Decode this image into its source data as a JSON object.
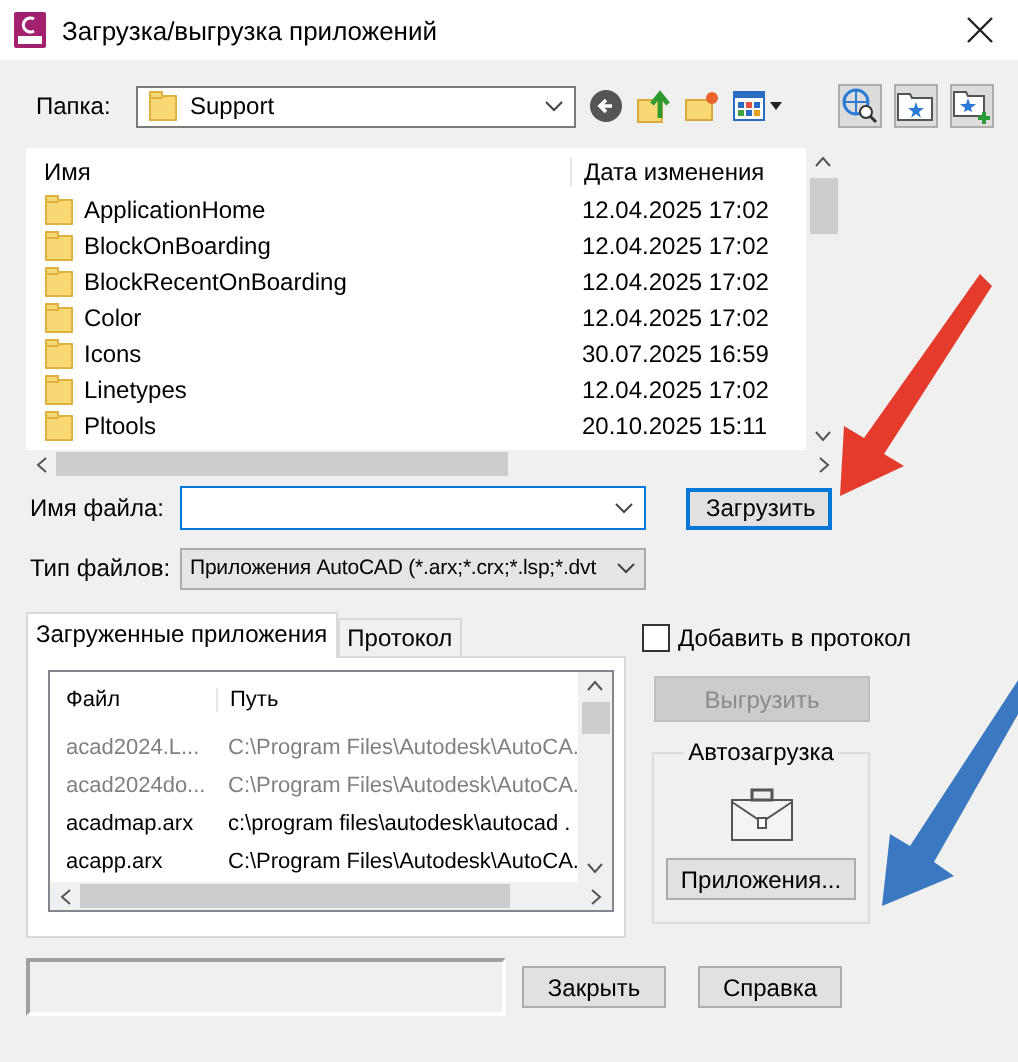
{
  "window": {
    "title": "Загрузка/выгрузка приложений"
  },
  "folder": {
    "label": "Папка:",
    "value": "Support"
  },
  "file_list": {
    "columns": [
      "Имя",
      "Дата изменения"
    ],
    "rows": [
      {
        "name": "ApplicationHome",
        "date": "12.04.2025 17:02"
      },
      {
        "name": "BlockOnBoarding",
        "date": "12.04.2025 17:02"
      },
      {
        "name": "BlockRecentOnBoarding",
        "date": "12.04.2025 17:02"
      },
      {
        "name": "Color",
        "date": "12.04.2025 17:02"
      },
      {
        "name": "Icons",
        "date": "30.07.2025 16:59"
      },
      {
        "name": "Linetypes",
        "date": "12.04.2025 17:02"
      },
      {
        "name": "Pltools",
        "date": "20.10.2025 15:11"
      }
    ]
  },
  "file_name": {
    "label": "Имя файла:"
  },
  "file_type": {
    "label": "Тип файлов:",
    "value": "Приложения AutoCAD (*.arx;*.crx;*.lsp;*.dvt"
  },
  "load_button": {
    "label": "Загрузить",
    "focused": true
  },
  "tabs": [
    {
      "label": "Загруженные приложения",
      "selected": true
    },
    {
      "label": "Протокол",
      "selected": false
    }
  ],
  "loaded_apps": {
    "columns": [
      "Файл",
      "Путь"
    ],
    "rows": [
      {
        "file": "acad2024.L...",
        "path": "C:\\Program Files\\Autodesk\\AutoCA.",
        "disabled": true
      },
      {
        "file": "acad2024do...",
        "path": "C:\\Program Files\\Autodesk\\AutoCA.",
        "disabled": true
      },
      {
        "file": "acadmap.arx",
        "path": "c:\\program files\\autodesk\\autocad .",
        "disabled": false
      },
      {
        "file": "acapp.arx",
        "path": "C:\\Program Files\\Autodesk\\AutoCA.",
        "disabled": false
      }
    ]
  },
  "add_to_log": {
    "label": "Добавить в протокол",
    "checked": false
  },
  "unload_button": {
    "label": "Выгрузить",
    "disabled": true
  },
  "startup": {
    "title": "Автозагрузка",
    "button": "Приложения..."
  },
  "buttons": [
    "Закрыть",
    "Справка"
  ],
  "annotations": [
    {
      "color": "#e53b2c"
    },
    {
      "color": "#3a78c2"
    }
  ]
}
